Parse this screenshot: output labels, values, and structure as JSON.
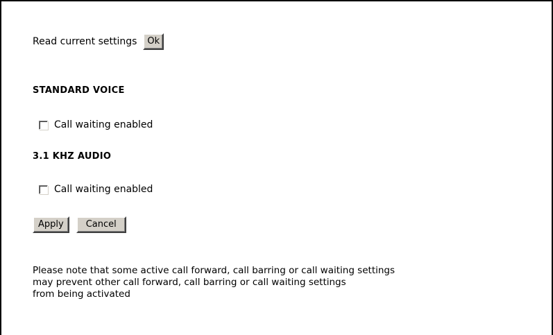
{
  "read_settings": {
    "label": "Read current settings",
    "ok_label": "Ok"
  },
  "standard_voice": {
    "heading": "STANDARD VOICE",
    "call_waiting_label": "Call waiting enabled",
    "call_waiting_checked": false
  },
  "khz_audio": {
    "heading": "3.1 KHZ AUDIO",
    "call_waiting_label": "Call waiting enabled",
    "call_waiting_checked": false
  },
  "actions": {
    "apply_label": "Apply",
    "cancel_label": "Cancel"
  },
  "note": {
    "lines": [
      "Please note that some active call forward, call barring or call waiting settings",
      "may prevent other call forward, call barring or call waiting settings",
      "from being activated"
    ]
  }
}
